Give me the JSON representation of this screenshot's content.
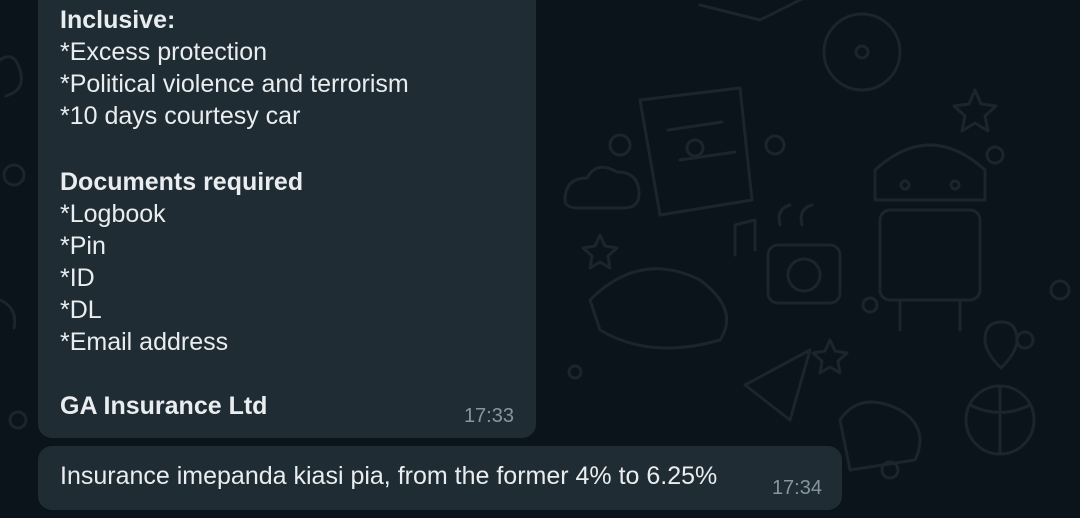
{
  "chat": {
    "messages": [
      {
        "lines": [
          "Inclusive:",
          "*Excess protection",
          "*Political violence and terrorism",
          "*10 days courtesy car",
          "",
          "Documents required",
          "*Logbook",
          "*Pin",
          "*ID",
          "*DL",
          "*Email address",
          "",
          "GA Insurance Ltd"
        ],
        "time": "17:33"
      },
      {
        "text": "Insurance imepanda kiasi pia, from the former 4% to 6.25%",
        "time": "17:34"
      }
    ]
  },
  "theme": {
    "background": "#0b141a",
    "bubble": "#202c33",
    "text": "#e9edef",
    "timestamp": "#8696a0"
  }
}
